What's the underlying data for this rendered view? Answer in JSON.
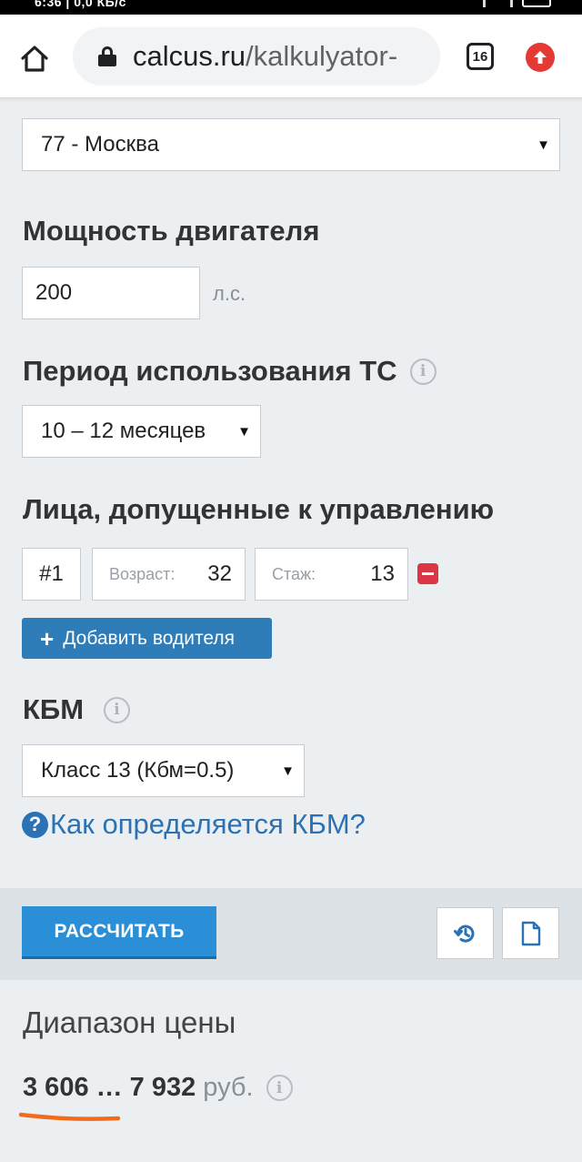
{
  "status_bar": {
    "text": "6:36 | 0,0 КБ/с"
  },
  "browser": {
    "url_domain": "calcus.ru",
    "url_path": "/kalkulyator-",
    "tab_count": "16"
  },
  "region": {
    "selected": "77 - Москва"
  },
  "engine_power": {
    "label": "Мощность двигателя",
    "value": "200",
    "unit": "л.с."
  },
  "usage_period": {
    "label": "Период использования ТС",
    "selected": "10 – 12 месяцев"
  },
  "drivers": {
    "label": "Лица, допущенные к управлению",
    "items": [
      {
        "number": "#1",
        "age_label": "Возраст:",
        "age": "32",
        "exp_label": "Стаж:",
        "exp": "13"
      }
    ],
    "add_label": "Добавить водителя"
  },
  "kbm": {
    "label": "КБМ",
    "selected": "Класс 13 (Кбм=0.5)",
    "help_link": "Как определяется КБМ?"
  },
  "actions": {
    "calculate_label": "РАССЧИТАТЬ"
  },
  "result": {
    "title": "Диапазон цены",
    "price_range": "3 606 … 7 932",
    "currency": "руб."
  },
  "colors": {
    "primary": "#2a8fd6",
    "add_button": "#2e7db8",
    "link": "#2b72b5",
    "remove": "#dc3545",
    "annotation_underline": "#f26a1b"
  }
}
